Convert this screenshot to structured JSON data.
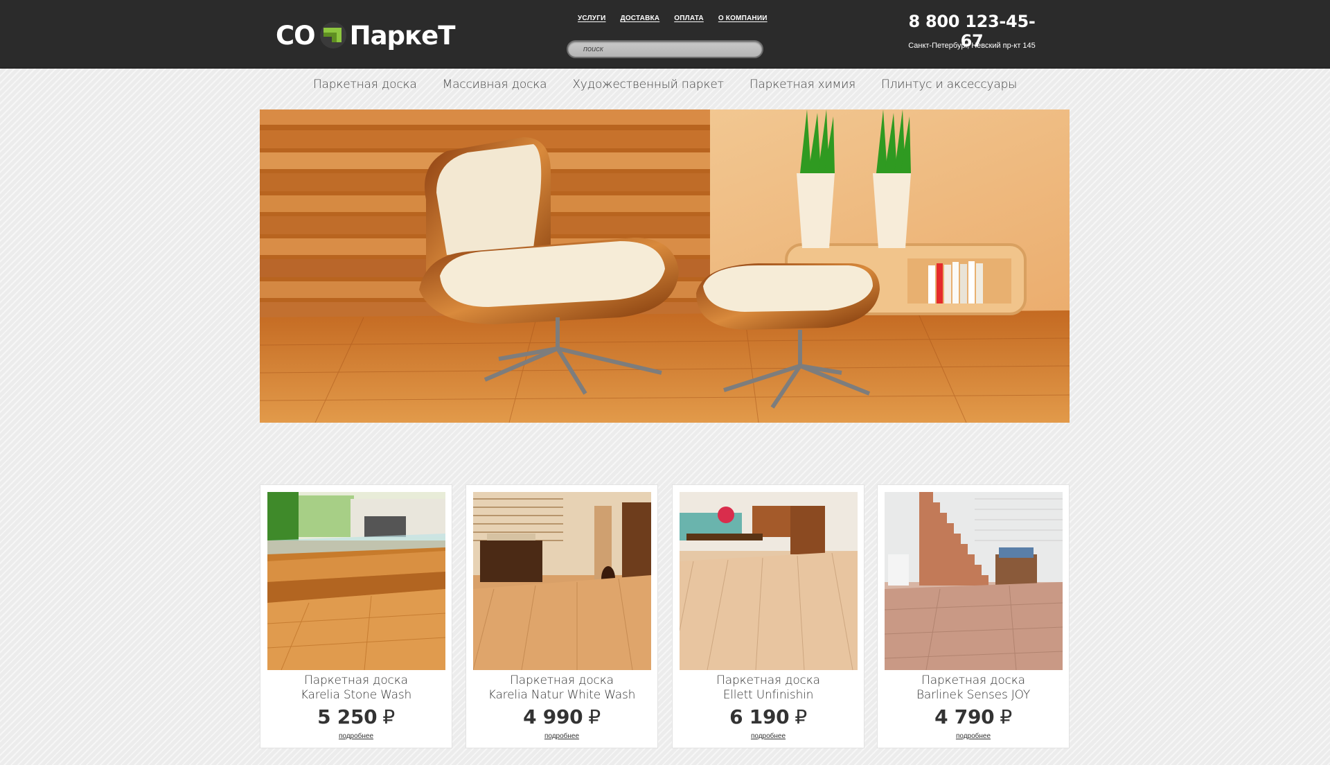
{
  "header": {
    "logo_left": "СО",
    "logo_right": "ПаркеТ",
    "nav": [
      "УСЛУГИ",
      "ДОСТАВКА",
      "ОПЛАТА",
      "О КОМПАНИИ"
    ],
    "search_placeholder": "поиск",
    "phone": "8 800 123-45-67",
    "address": "Санкт-Петербург, Невский пр-кт 145"
  },
  "categories": [
    "Паркетная доска",
    "Массивная доска",
    "Художественный паркет",
    "Паркетная химия",
    "Плинтус и аксессуары"
  ],
  "products": [
    {
      "title_line1": "Паркетная доска",
      "title_line2": "Karelia Stone Wash",
      "price": "5 250",
      "currency": "₽",
      "more": "подробнее"
    },
    {
      "title_line1": "Паркетная доска",
      "title_line2": "Karelia Natur White Wash",
      "price": "4 990",
      "currency": "₽",
      "more": "подробнее"
    },
    {
      "title_line1": "Паркетная доска",
      "title_line2": "Ellett Unfinishin",
      "price": "6 190",
      "currency": "₽",
      "more": "подробнее"
    },
    {
      "title_line1": "Паркетная доска",
      "title_line2": "Barlinek Senses JOY",
      "price": "4 790",
      "currency": "₽",
      "more": "подробнее"
    }
  ],
  "colors": {
    "header_bg": "#2b2b2b",
    "logo_accent": "#8dc63f",
    "page_bg": "#ececec"
  }
}
